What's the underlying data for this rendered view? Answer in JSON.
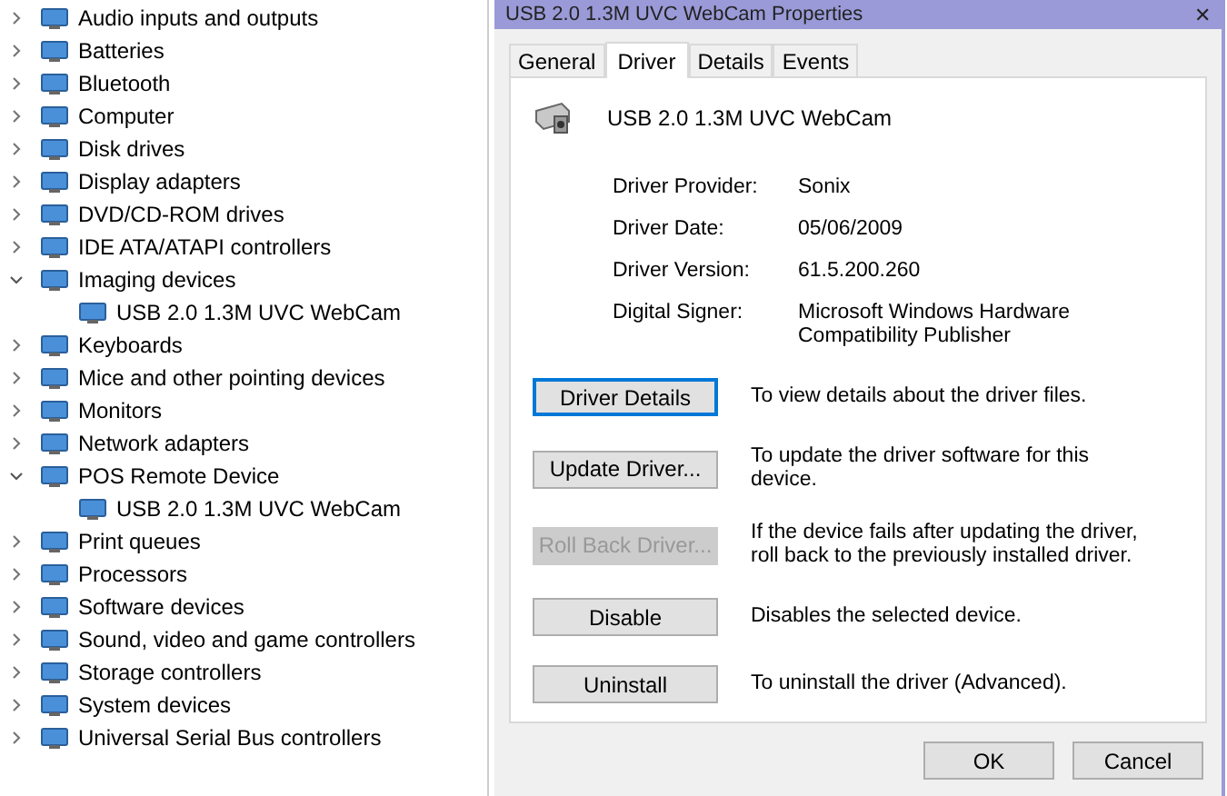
{
  "device_tree": [
    {
      "label": "Audio inputs and outputs",
      "expanded": false
    },
    {
      "label": "Batteries",
      "expanded": false
    },
    {
      "label": "Bluetooth",
      "expanded": false
    },
    {
      "label": "Computer",
      "expanded": false
    },
    {
      "label": "Disk drives",
      "expanded": false
    },
    {
      "label": "Display adapters",
      "expanded": false
    },
    {
      "label": "DVD/CD-ROM drives",
      "expanded": false
    },
    {
      "label": "IDE ATA/ATAPI controllers",
      "expanded": false
    },
    {
      "label": "Imaging devices",
      "expanded": true,
      "children": [
        {
          "label": "USB 2.0 1.3M UVC WebCam"
        }
      ]
    },
    {
      "label": "Keyboards",
      "expanded": false
    },
    {
      "label": "Mice and other pointing devices",
      "expanded": false
    },
    {
      "label": "Monitors",
      "expanded": false
    },
    {
      "label": "Network adapters",
      "expanded": false
    },
    {
      "label": "POS Remote Device",
      "expanded": true,
      "children": [
        {
          "label": "USB 2.0 1.3M UVC WebCam"
        }
      ]
    },
    {
      "label": "Print queues",
      "expanded": false
    },
    {
      "label": "Processors",
      "expanded": false
    },
    {
      "label": "Software devices",
      "expanded": false
    },
    {
      "label": "Sound, video and game controllers",
      "expanded": false
    },
    {
      "label": "Storage controllers",
      "expanded": false
    },
    {
      "label": "System devices",
      "expanded": false
    },
    {
      "label": "Universal Serial Bus controllers",
      "expanded": false
    }
  ],
  "dialog": {
    "title": "USB 2.0 1.3M UVC WebCam Properties",
    "close": "✕",
    "tabs": [
      {
        "label": "General",
        "selected": false
      },
      {
        "label": "Driver",
        "selected": true
      },
      {
        "label": "Details",
        "selected": false
      },
      {
        "label": "Events",
        "selected": false
      }
    ],
    "device_name": "USB 2.0 1.3M UVC WebCam",
    "properties": [
      {
        "label": "Driver Provider:",
        "value": "Sonix"
      },
      {
        "label": "Driver Date:",
        "value": "05/06/2009"
      },
      {
        "label": "Driver Version:",
        "value": "61.5.200.260"
      },
      {
        "label": "Digital Signer:",
        "value": "Microsoft Windows Hardware Compatibility Publisher"
      }
    ],
    "actions": [
      {
        "button": "Driver Details",
        "description": "To view details about the driver files.",
        "disabled": false,
        "focused": true
      },
      {
        "button": "Update Driver...",
        "description": "To update the driver software for this device.",
        "disabled": false,
        "focused": false
      },
      {
        "button": "Roll Back Driver...",
        "description": "If the device fails after updating the driver, roll back to the previously installed driver.",
        "disabled": true,
        "focused": false
      },
      {
        "button": "Disable",
        "description": "Disables the selected device.",
        "disabled": false,
        "focused": false
      },
      {
        "button": "Uninstall",
        "description": "To uninstall the driver (Advanced).",
        "disabled": false,
        "focused": false
      }
    ],
    "buttons": [
      "OK",
      "Cancel"
    ]
  }
}
